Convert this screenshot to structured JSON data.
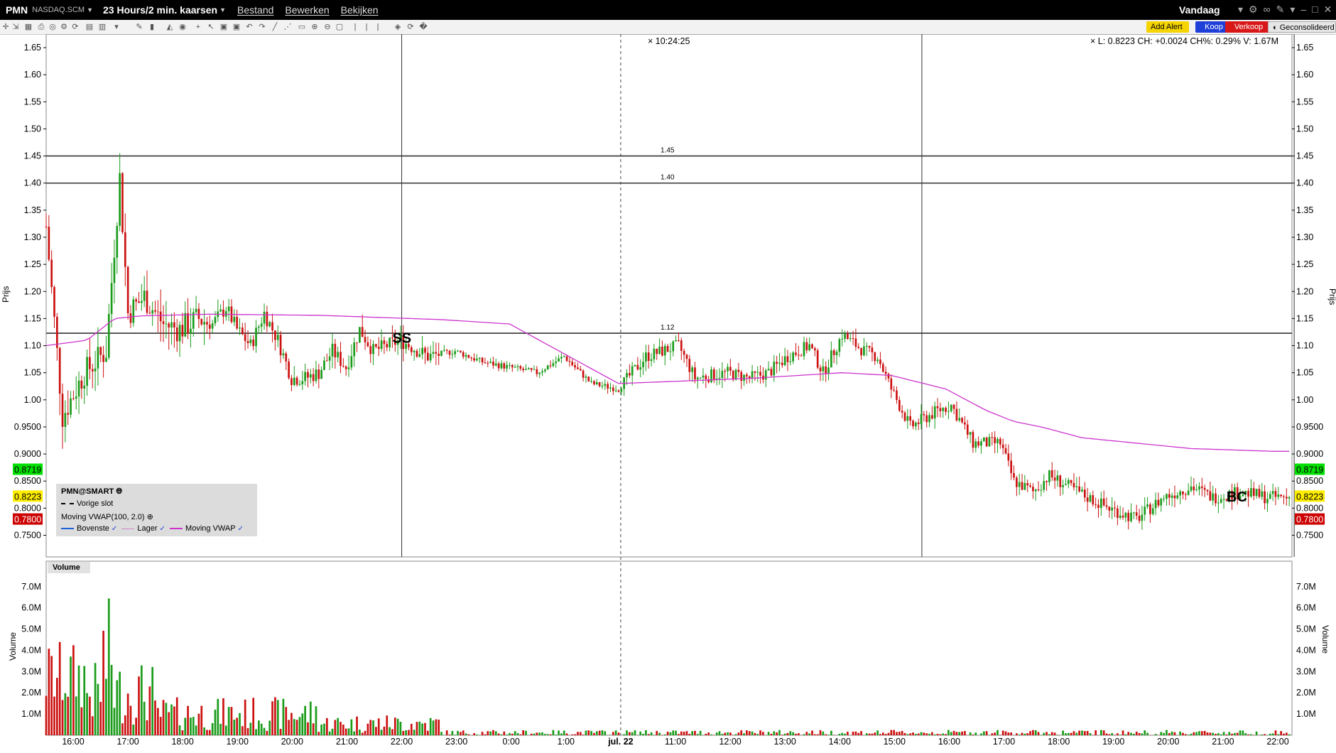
{
  "header": {
    "symbol": "PMN",
    "exchange": "NASDAQ.SCM",
    "period": "23 Hours/2 min. kaarsen",
    "menu": [
      "Bestand",
      "Bewerken",
      "Bekijken"
    ],
    "range": "Vandaag"
  },
  "toolbar": {
    "icons": [
      "crosshair-icon",
      "drag-icon",
      "grid-icon",
      "print-icon",
      "camera-icon",
      "settings-icon",
      "refresh-icon",
      "layout-icon",
      "chart-type-icon",
      "down-icon",
      "pencil-icon",
      "bars-icon",
      "area-icon",
      "globe-icon",
      "cross-icon",
      "cursor-icon",
      "zoom-box-icon",
      "zoom-box2-icon",
      "undo-icon",
      "redo-icon",
      "trendline-icon",
      "fib-icon",
      "ruler-icon",
      "zoom-in-icon",
      "zoom-out-icon",
      "zoom-fit-icon",
      "pan-icon",
      "pan2-icon",
      "pan3-icon",
      "shield-icon",
      "reload-icon",
      "wrench-icon"
    ],
    "add_alert": "Add Alert",
    "buy": "Koop",
    "sell": "Verkoop",
    "consolidated": "Geconsolideerd"
  },
  "status": {
    "time": "10:24:25",
    "ohlc": "L: 0.8223 CH: +0.0024 CH%: 0.29%  V: 1.67M"
  },
  "legend": {
    "title": "PMN@SMART",
    "prev_close": "Vorige slot",
    "indicator": "Moving VWAP(100, 2.0)",
    "upper": "Bovenste",
    "lower": "Lager",
    "vwap": "Moving VWAP"
  },
  "colors": {
    "up": "#1a9c1a",
    "down": "#cc1111",
    "vwap": "#cc33cc",
    "highlight_green": "#00e000",
    "highlight_yellow": "#ffee00",
    "highlight_red": "#cc0000"
  },
  "chart_data": {
    "type": "candlestick",
    "price_axis": {
      "label": "Prijs",
      "ylim": [
        0.71,
        1.675
      ],
      "ticks": [
        1.65,
        1.6,
        1.55,
        1.5,
        1.45,
        1.4,
        1.35,
        1.3,
        1.25,
        1.2,
        1.15,
        1.1,
        1.05,
        1.0,
        0.95,
        0.9,
        0.85,
        0.8,
        0.75
      ],
      "tick_labels": [
        "1.65",
        "1.60",
        "1.55",
        "1.50",
        "1.45",
        "1.40",
        "1.35",
        "1.30",
        "1.25",
        "1.20",
        "1.15",
        "1.10",
        "1.05",
        "1.00",
        "0.9500",
        "0.9000",
        "0.8500",
        "0.8000",
        "0.7500"
      ],
      "markers": [
        {
          "value": 0.8719,
          "label": "0.8719",
          "color": "green"
        },
        {
          "value": 0.8223,
          "label": "0.8223",
          "color": "yellow"
        },
        {
          "value": 0.78,
          "label": "0.7800",
          "color": "red"
        }
      ]
    },
    "volume_axis": {
      "label": "Volume",
      "title": "Volume",
      "ylim": [
        0,
        8200000
      ],
      "ticks": [
        1000000,
        2000000,
        3000000,
        4000000,
        5000000,
        6000000,
        7000000
      ],
      "tick_labels": [
        "1.0M",
        "2.0M",
        "3.0M",
        "4.0M",
        "5.0M",
        "6.0M",
        "7.0M"
      ]
    },
    "time_axis": {
      "labels": [
        "16:00",
        "17:00",
        "18:00",
        "19:00",
        "20:00",
        "21:00",
        "22:00",
        "23:00",
        "0:00",
        "1:00",
        "jul. 22",
        "11:00",
        "12:00",
        "13:00",
        "14:00",
        "15:00",
        "16:00",
        "17:00",
        "18:00",
        "19:00",
        "20:00",
        "21:00",
        "22:00"
      ],
      "bold_label": "jul. 22"
    },
    "hlines": [
      {
        "value": 1.45,
        "label": "1.45"
      },
      {
        "value": 1.4,
        "label": "1.40"
      },
      {
        "value": 1.1229,
        "label": "1.12"
      }
    ],
    "vlines": [
      "22:00",
      "15:30",
      "22:00"
    ],
    "session_break": "jul. 22",
    "annotations": [
      {
        "text": "SS"
      },
      {
        "text": "BC"
      }
    ],
    "price_path": [
      [
        0,
        1.32
      ],
      [
        6,
        0.97
      ],
      [
        14,
        1.05
      ],
      [
        22,
        1.09
      ],
      [
        27,
        1.41
      ],
      [
        30,
        1.16
      ],
      [
        36,
        1.19
      ],
      [
        43,
        1.14
      ],
      [
        49,
        1.13
      ],
      [
        56,
        1.15
      ],
      [
        61,
        1.14
      ],
      [
        66,
        1.17
      ],
      [
        70,
        1.13
      ],
      [
        75,
        1.1
      ],
      [
        80,
        1.16
      ],
      [
        85,
        1.11
      ],
      [
        90,
        1.04
      ],
      [
        95,
        1.04
      ],
      [
        100,
        1.05
      ],
      [
        105,
        1.09
      ],
      [
        110,
        1.06
      ],
      [
        115,
        1.13
      ],
      [
        120,
        1.09
      ],
      [
        130,
        1.11
      ],
      [
        140,
        1.08
      ],
      [
        150,
        1.09
      ],
      [
        160,
        1.07
      ],
      [
        170,
        1.06
      ],
      [
        180,
        1.05
      ],
      [
        190,
        1.08
      ],
      [
        200,
        1.03
      ],
      [
        210,
        1.02
      ],
      [
        220,
        1.08
      ],
      [
        232,
        1.1
      ],
      [
        238,
        1.04
      ],
      [
        250,
        1.05
      ],
      [
        258,
        1.04
      ],
      [
        265,
        1.05
      ],
      [
        272,
        1.08
      ],
      [
        280,
        1.1
      ],
      [
        285,
        1.05
      ],
      [
        292,
        1.12
      ],
      [
        300,
        1.09
      ],
      [
        305,
        1.08
      ],
      [
        310,
        1.02
      ],
      [
        317,
        0.95
      ],
      [
        327,
        0.98
      ],
      [
        332,
        0.99
      ],
      [
        340,
        0.92
      ],
      [
        350,
        0.92
      ],
      [
        355,
        0.85
      ],
      [
        362,
        0.83
      ],
      [
        368,
        0.86
      ],
      [
        375,
        0.84
      ],
      [
        382,
        0.82
      ],
      [
        390,
        0.8
      ],
      [
        400,
        0.78
      ],
      [
        410,
        0.82
      ],
      [
        420,
        0.84
      ],
      [
        428,
        0.82
      ],
      [
        438,
        0.83
      ],
      [
        448,
        0.82
      ],
      [
        457,
        0.82
      ]
    ],
    "vwap_path": [
      [
        0,
        1.1
      ],
      [
        15,
        1.11
      ],
      [
        25,
        1.15
      ],
      [
        35,
        1.155
      ],
      [
        60,
        1.158
      ],
      [
        100,
        1.156
      ],
      [
        145,
        1.148
      ],
      [
        170,
        1.14
      ],
      [
        210,
        1.03
      ],
      [
        260,
        1.04
      ],
      [
        292,
        1.05
      ],
      [
        310,
        1.045
      ],
      [
        330,
        1.02
      ],
      [
        345,
        0.98
      ],
      [
        355,
        0.96
      ],
      [
        365,
        0.95
      ],
      [
        380,
        0.93
      ],
      [
        420,
        0.91
      ],
      [
        450,
        0.905
      ],
      [
        457,
        0.905
      ]
    ]
  }
}
